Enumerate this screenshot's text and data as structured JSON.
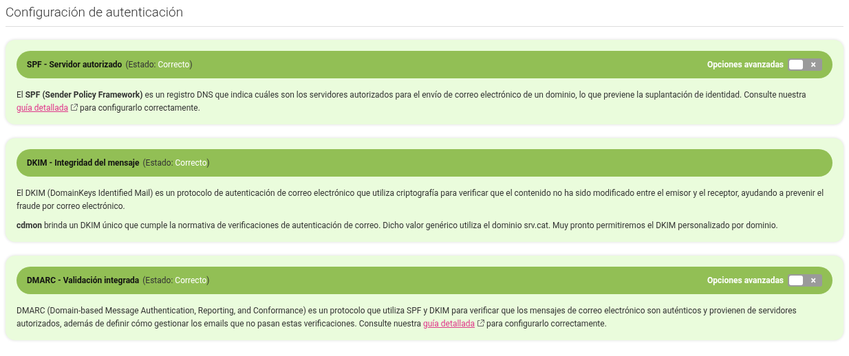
{
  "title": "Configuración de autenticación",
  "sections": [
    {
      "name": "SPF - Servidor autorizado",
      "status_label": "(Estado: ",
      "status": "Correcto",
      "status_end": ")",
      "advanced": {
        "label": "Opciones avanzadas",
        "on": false,
        "off_mark": "×"
      },
      "paragraphs": [
        {
          "before": "El **SPF (Sender Policy Framework)** es un registro DNS que indica cuáles son los servidores autorizados para el envío de correo electrónico de un dominio, lo que previene la suplantación de identidad. Consulte nuestra",
          "link": "guía detallada",
          "after": "para configurarlo correctamente."
        }
      ]
    },
    {
      "name": "DKIM - Integridad del mensaje",
      "status_label": "(Estado: ",
      "status": "Correcto",
      "status_end": ")",
      "paragraphs": [
        {
          "before": "El DKIM (DomainKeys Identified Mail) es un protocolo de autenticación de correo electrónico que utiliza criptografía para verificar que el contenido no ha sido modificado entre el emisor y el receptor, ayudando a prevenir el fraude por correo electrónico."
        },
        {
          "before": "**cdmon** brinda un DKIM único que cumple la normativa de verificaciones de autenticación de correo. Dicho valor genérico utiliza el dominio srv.cat. Muy pronto permitiremos el DKIM personalizado por dominio."
        }
      ]
    },
    {
      "name": "DMARC - Validación integrada",
      "status_label": "(Estado: ",
      "status": "Correcto",
      "status_end": ")",
      "advanced": {
        "label": "Opciones avanzadas",
        "on": false,
        "off_mark": "×"
      },
      "paragraphs": [
        {
          "before": "DMARC (Domain-based Message Authentication, Reporting, and Conformance) es un protocolo que utiliza SPF y DKIM para verificar que los mensajes de correo electrónico son auténticos y provienen de servidores autorizados, además de definir cómo gestionar los emails que no pasan estas verificaciones. Consulte nuestra",
          "link": "guía detallada",
          "after": "para configurarlo correctamente."
        }
      ]
    }
  ]
}
